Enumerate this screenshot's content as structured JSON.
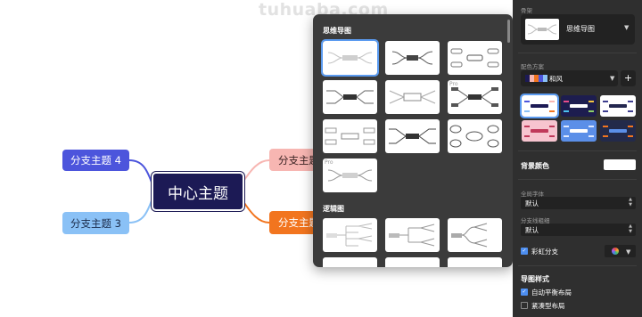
{
  "watermark": "tuhuaba.com",
  "mindmap": {
    "center": "中心主题",
    "branch_left_top": "分支主题 4",
    "branch_left_bottom": "分支主题 3",
    "branch_right_top": "分支主题",
    "branch_right_bottom": "分支主题"
  },
  "template_popup": {
    "section_mindmap": "思维导图",
    "section_logic": "逻辑图",
    "pro_badge": "Pro"
  },
  "right_panel": {
    "structure_label": "骨架",
    "structure_value": "思维导图",
    "color_scheme_label": "配色方案",
    "color_scheme_value": "和风",
    "add_label": "+",
    "swatch_colors": [
      "#1c1a55",
      "#f7b6b2",
      "#f2751f",
      "#4c55dc",
      "#8ac1f6"
    ],
    "background_label": "背景颜色",
    "global_font_label": "全局字体",
    "global_font_value": "默认",
    "branch_width_label": "分支线粗细",
    "branch_width_value": "默认",
    "rainbow_label": "彩虹分支",
    "map_style_label": "导图样式",
    "auto_balance_label": "自动平衡布局",
    "compact_label": "紧凑型布局"
  },
  "colors": {
    "accent": "#5b9bf0",
    "panel_bg": "#2f2f2f",
    "popup_bg": "#3b3b3b"
  }
}
